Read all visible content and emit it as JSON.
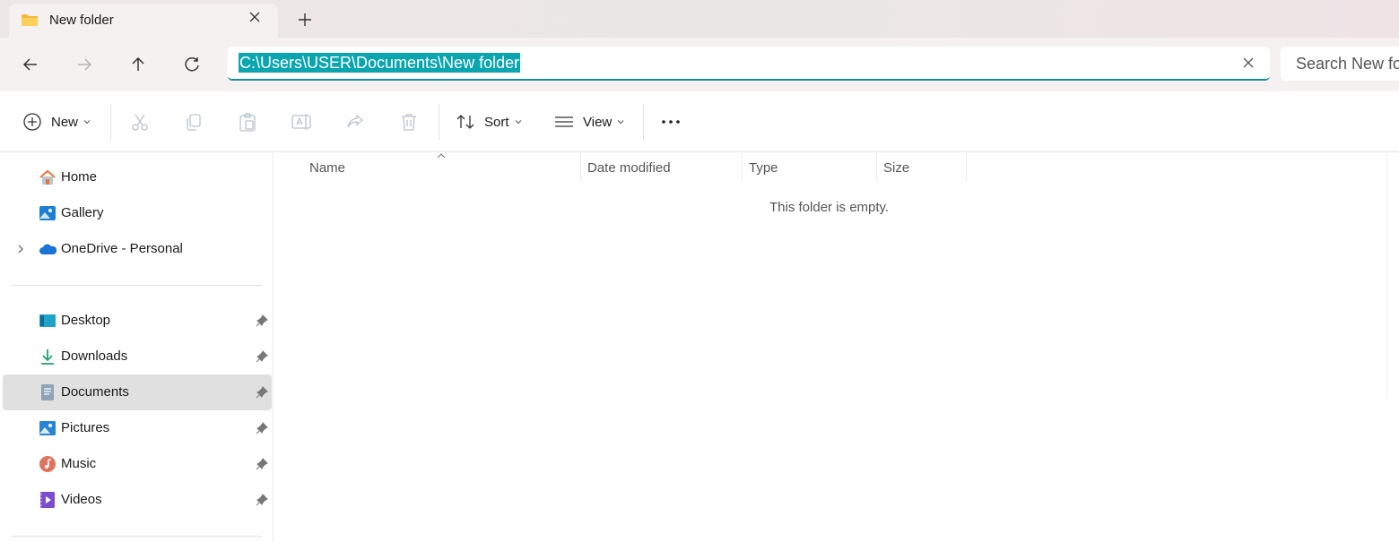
{
  "tab": {
    "title": "New folder",
    "close_icon": "close-icon",
    "new_tab_icon": "plus-icon"
  },
  "nav": {
    "back": "back-arrow-icon",
    "forward": "forward-arrow-icon",
    "up": "up-arrow-icon",
    "refresh": "refresh-icon"
  },
  "address": {
    "value": "C:\\Users\\USER\\Documents\\New folder",
    "highlight_color": "#0ba5b0"
  },
  "search": {
    "placeholder": "Search New folder"
  },
  "commands": {
    "new_label": "New",
    "sort_label": "Sort",
    "view_label": "View",
    "icons": [
      "cut-icon",
      "copy-icon",
      "paste-icon",
      "rename-icon",
      "share-icon",
      "delete-icon"
    ]
  },
  "sidebar": {
    "group1": [
      {
        "label": "Home",
        "icon": "home-icon"
      },
      {
        "label": "Gallery",
        "icon": "gallery-icon"
      },
      {
        "label": "OneDrive - Personal",
        "icon": "onedrive-icon",
        "expandable": true
      }
    ],
    "group2": [
      {
        "label": "Desktop",
        "icon": "desktop-icon",
        "pinned": true
      },
      {
        "label": "Downloads",
        "icon": "downloads-icon",
        "pinned": true
      },
      {
        "label": "Documents",
        "icon": "documents-icon",
        "pinned": true,
        "selected": true
      },
      {
        "label": "Pictures",
        "icon": "pictures-icon",
        "pinned": true
      },
      {
        "label": "Music",
        "icon": "music-icon",
        "pinned": true
      },
      {
        "label": "Videos",
        "icon": "videos-icon",
        "pinned": true
      }
    ]
  },
  "content": {
    "columns": [
      "Name",
      "Date modified",
      "Type",
      "Size"
    ],
    "empty_message": "This folder is empty."
  }
}
